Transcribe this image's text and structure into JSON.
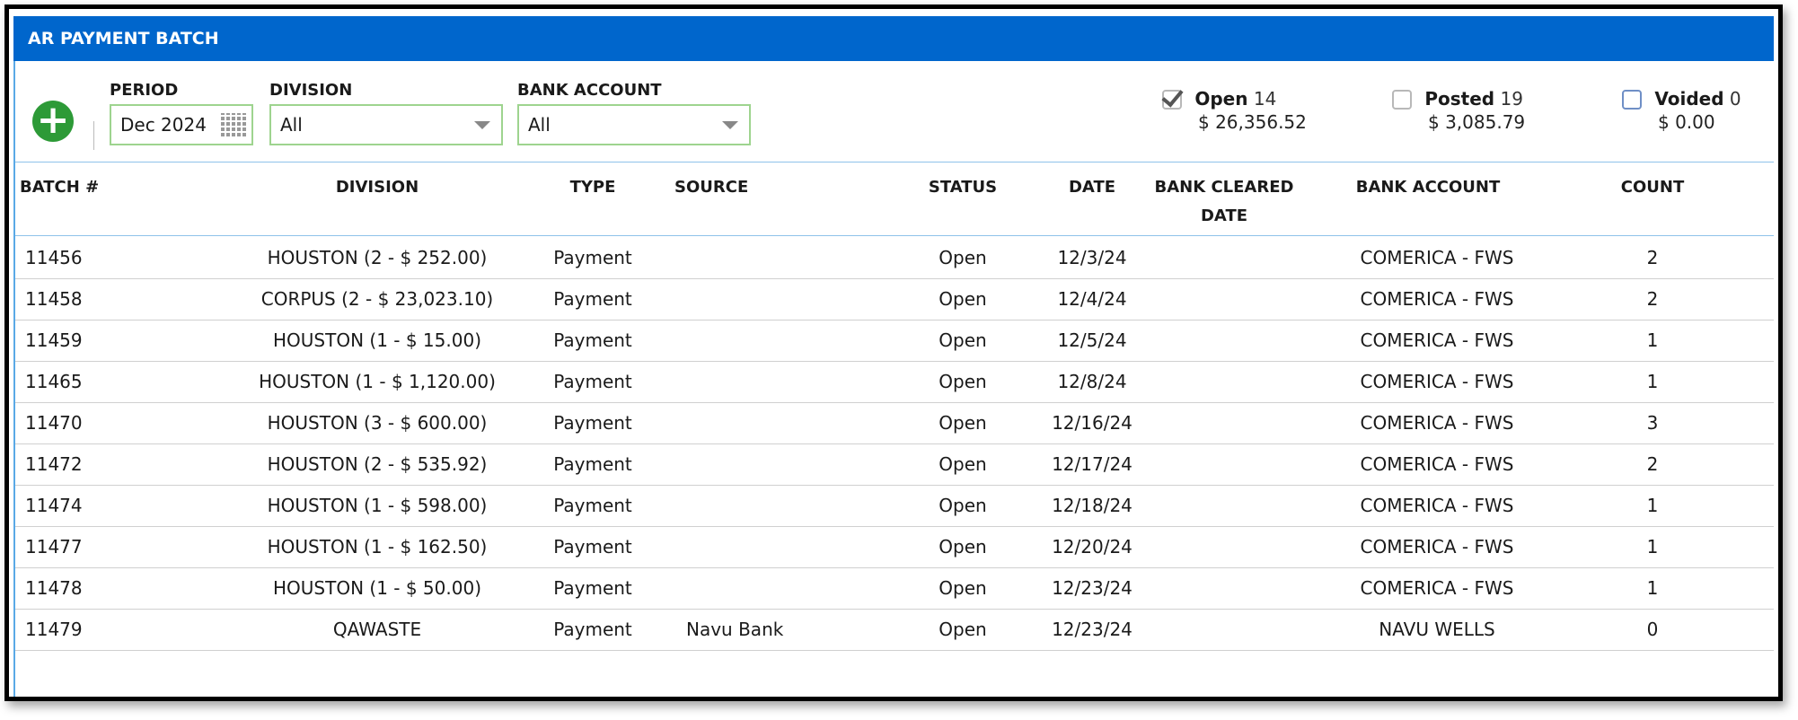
{
  "window": {
    "title": "AR PAYMENT BATCH"
  },
  "filters": {
    "period_label": "PERIOD",
    "period_value": "Dec 2024",
    "division_label": "DIVISION",
    "division_value": "All",
    "bank_label": "BANK ACCOUNT",
    "bank_value": "All"
  },
  "summary": {
    "open": {
      "label": "Open",
      "count": "14",
      "amount": "$ 26,356.52",
      "checked": true
    },
    "posted": {
      "label": "Posted",
      "count": "19",
      "amount": "$ 3,085.79",
      "checked": false
    },
    "voided": {
      "label": "Voided",
      "count": "0",
      "amount": "$ 0.00",
      "checked": false
    }
  },
  "table": {
    "headers": [
      "BATCH #",
      "DIVISION",
      "TYPE",
      "SOURCE",
      "STATUS",
      "DATE",
      "BANK CLEARED DATE",
      "BANK ACCOUNT",
      "COUNT"
    ],
    "rows": [
      [
        "11456",
        "HOUSTON (2 - $ 252.00)",
        "Payment",
        "",
        "Open",
        "12/3/24",
        "",
        "COMERICA - FWS",
        "2"
      ],
      [
        "11458",
        "CORPUS (2 - $ 23,023.10)",
        "Payment",
        "",
        "Open",
        "12/4/24",
        "",
        "COMERICA - FWS",
        "2"
      ],
      [
        "11459",
        "HOUSTON (1 - $ 15.00)",
        "Payment",
        "",
        "Open",
        "12/5/24",
        "",
        "COMERICA - FWS",
        "1"
      ],
      [
        "11465",
        "HOUSTON (1 - $ 1,120.00)",
        "Payment",
        "",
        "Open",
        "12/8/24",
        "",
        "COMERICA - FWS",
        "1"
      ],
      [
        "11470",
        "HOUSTON (3 - $ 600.00)",
        "Payment",
        "",
        "Open",
        "12/16/24",
        "",
        "COMERICA - FWS",
        "3"
      ],
      [
        "11472",
        "HOUSTON (2 - $ 535.92)",
        "Payment",
        "",
        "Open",
        "12/17/24",
        "",
        "COMERICA - FWS",
        "2"
      ],
      [
        "11474",
        "HOUSTON (1 - $ 598.00)",
        "Payment",
        "",
        "Open",
        "12/18/24",
        "",
        "COMERICA - FWS",
        "1"
      ],
      [
        "11477",
        "HOUSTON (1 - $ 162.50)",
        "Payment",
        "",
        "Open",
        "12/20/24",
        "",
        "COMERICA - FWS",
        "1"
      ],
      [
        "11478",
        "HOUSTON (1 - $ 50.00)",
        "Payment",
        "",
        "Open",
        "12/23/24",
        "",
        "COMERICA - FWS",
        "1"
      ],
      [
        "11479",
        "QAWASTE",
        "Payment",
        "Navu Bank",
        "Open",
        "12/23/24",
        "",
        "NAVU WELLS",
        "0"
      ]
    ]
  },
  "colors": {
    "titlebar": "#0066cc",
    "add_button": "#2d9a37",
    "field_border": "#9ed48f"
  },
  "icons": {
    "add": "plus-circle-icon",
    "calendar": "calendar-grid-icon",
    "dropdown": "chevron-down-icon"
  }
}
